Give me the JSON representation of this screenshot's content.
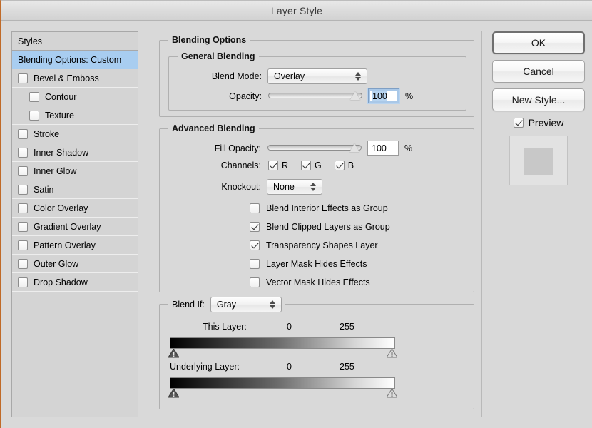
{
  "window": {
    "title": "Layer Style"
  },
  "sidebar": {
    "header": "Styles",
    "items": [
      {
        "label": "Blending Options: Custom",
        "selected": true,
        "checkbox": false,
        "indent": false
      },
      {
        "label": "Bevel & Emboss",
        "selected": false,
        "checkbox": true,
        "checked": false,
        "indent": false
      },
      {
        "label": "Contour",
        "selected": false,
        "checkbox": true,
        "checked": false,
        "indent": true
      },
      {
        "label": "Texture",
        "selected": false,
        "checkbox": true,
        "checked": false,
        "indent": true
      },
      {
        "label": "Stroke",
        "selected": false,
        "checkbox": true,
        "checked": false,
        "indent": false
      },
      {
        "label": "Inner Shadow",
        "selected": false,
        "checkbox": true,
        "checked": false,
        "indent": false
      },
      {
        "label": "Inner Glow",
        "selected": false,
        "checkbox": true,
        "checked": false,
        "indent": false
      },
      {
        "label": "Satin",
        "selected": false,
        "checkbox": true,
        "checked": false,
        "indent": false
      },
      {
        "label": "Color Overlay",
        "selected": false,
        "checkbox": true,
        "checked": false,
        "indent": false
      },
      {
        "label": "Gradient Overlay",
        "selected": false,
        "checkbox": true,
        "checked": false,
        "indent": false
      },
      {
        "label": "Pattern Overlay",
        "selected": false,
        "checkbox": true,
        "checked": false,
        "indent": false
      },
      {
        "label": "Outer Glow",
        "selected": false,
        "checkbox": true,
        "checked": false,
        "indent": false
      },
      {
        "label": "Drop Shadow",
        "selected": false,
        "checkbox": true,
        "checked": false,
        "indent": false
      }
    ]
  },
  "blending_options": {
    "legend": "Blending Options",
    "general": {
      "legend": "General Blending",
      "blend_mode_label": "Blend Mode:",
      "blend_mode_value": "Overlay",
      "opacity_label": "Opacity:",
      "opacity_value": "100",
      "opacity_unit": "%",
      "opacity_percent": 100
    },
    "advanced": {
      "legend": "Advanced Blending",
      "fill_opacity_label": "Fill Opacity:",
      "fill_opacity_value": "100",
      "fill_opacity_unit": "%",
      "fill_opacity_percent": 100,
      "channels_label": "Channels:",
      "channels": [
        {
          "name": "R",
          "checked": true
        },
        {
          "name": "G",
          "checked": true
        },
        {
          "name": "B",
          "checked": true
        }
      ],
      "knockout_label": "Knockout:",
      "knockout_value": "None",
      "options": [
        {
          "label": "Blend Interior Effects as Group",
          "checked": false
        },
        {
          "label": "Blend Clipped Layers as Group",
          "checked": true
        },
        {
          "label": "Transparency Shapes Layer",
          "checked": true
        },
        {
          "label": "Layer Mask Hides Effects",
          "checked": false
        },
        {
          "label": "Vector Mask Hides Effects",
          "checked": false
        }
      ]
    },
    "blend_if": {
      "label": "Blend If:",
      "channel_value": "Gray",
      "this_layer": {
        "label": "This Layer:",
        "min": "0",
        "max": "255"
      },
      "underlying_layer": {
        "label": "Underlying Layer:",
        "min": "0",
        "max": "255"
      }
    }
  },
  "buttons": {
    "ok": "OK",
    "cancel": "Cancel",
    "new_style": "New Style...",
    "preview_label": "Preview",
    "preview_checked": true
  },
  "colors": {
    "dialog_bg": "#d9d9d9",
    "selection_blue": "#a8cdf0",
    "field_selection": "#b7d4f0",
    "border": "#b0b0b0"
  }
}
